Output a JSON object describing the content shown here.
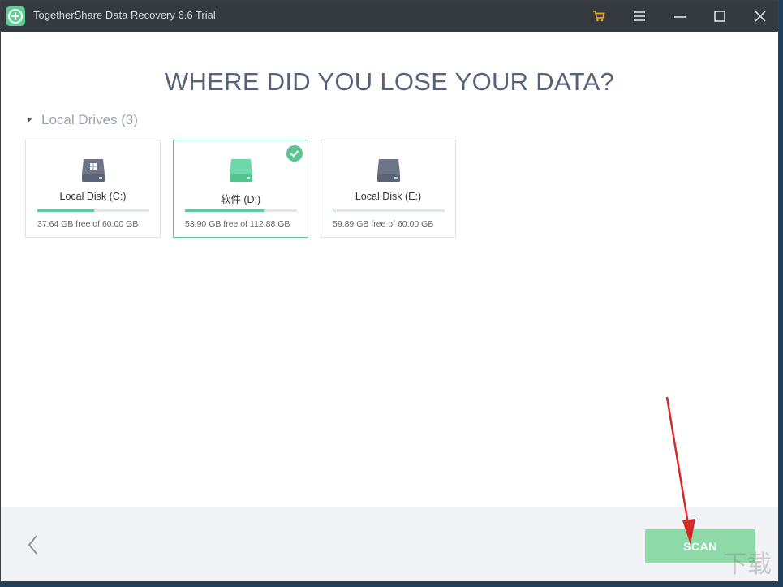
{
  "window": {
    "title": "TogetherShare Data Recovery 6.6 Trial"
  },
  "heading": "WHERE DID YOU LOSE YOUR DATA?",
  "section": {
    "label": "Local Drives (3)"
  },
  "drives": [
    {
      "name": "Local Disk (C:)",
      "free_text": "37.64 GB free of 60.00 GB",
      "used_fraction": 0.51,
      "selected": false,
      "icon": "windows-disk-icon"
    },
    {
      "name": "软件 (D:)",
      "free_text": "53.90 GB free of 112.88 GB",
      "used_fraction": 0.7,
      "selected": true,
      "icon": "disk-icon"
    },
    {
      "name": "Local Disk (E:)",
      "free_text": "59.89 GB free of 60.00 GB",
      "used_fraction": 0.01,
      "selected": false,
      "icon": "disk-icon"
    }
  ],
  "footer": {
    "scan_label": "SCAN"
  },
  "colors": {
    "titlebar": "#343a40",
    "accent": "#62c89b",
    "scan_button": "#8ed9a8",
    "cart": "#f0a020"
  },
  "watermark": "下载"
}
